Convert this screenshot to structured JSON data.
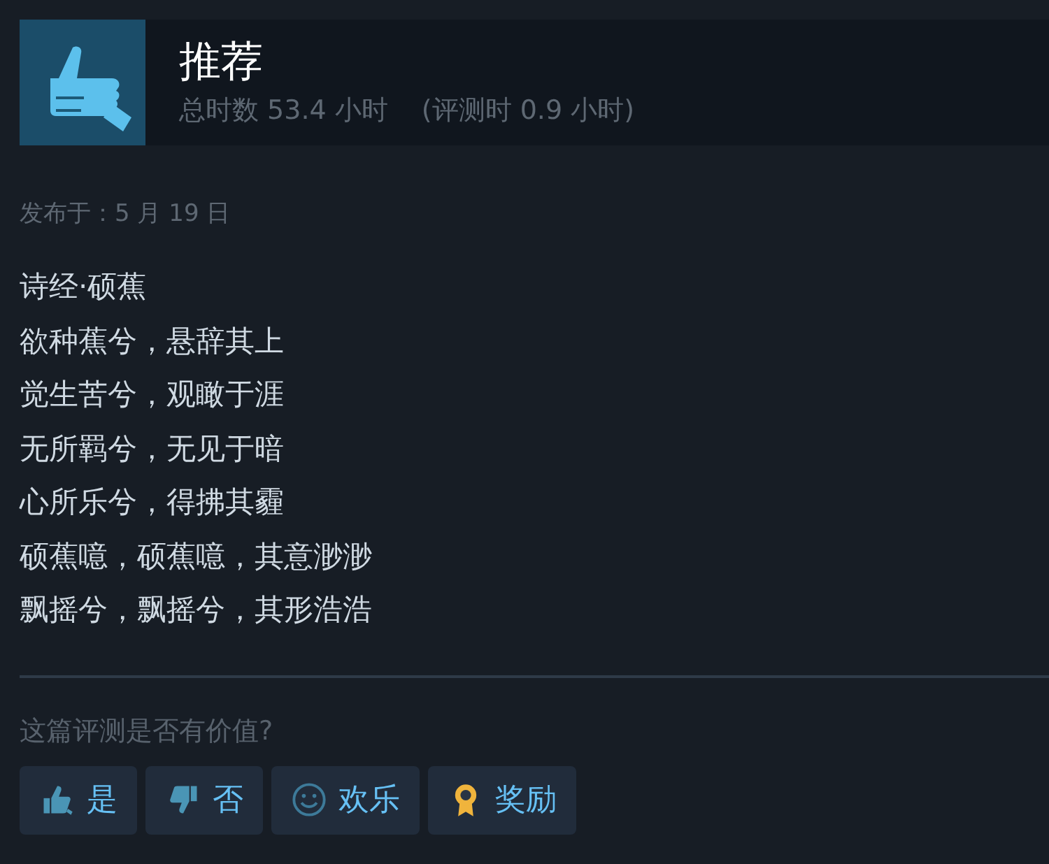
{
  "review": {
    "verdict": "推荐",
    "kind": "recommended",
    "total_hours": "总时数 53.4 小时",
    "review_hours": "(评测时 0.9 小时)"
  },
  "posted": "发布于：5 月 19 日",
  "body": [
    "诗经·硕蕉",
    "欲种蕉兮，悬辞其上",
    "觉生苦兮，观瞰于涯",
    "无所羁兮，无见于暗",
    "心所乐兮，得拂其霾",
    "硕蕉噫，硕蕉噫，其意渺渺",
    "飘摇兮，飘摇兮，其形浩浩"
  ],
  "helpful_prompt": "这篇评测是否有价值?",
  "buttons": [
    {
      "label": "是",
      "kind": "thumb-up"
    },
    {
      "label": "否",
      "kind": "thumb-down"
    },
    {
      "label": "欢乐",
      "kind": "smile"
    },
    {
      "label": "奖励",
      "kind": "award"
    }
  ]
}
